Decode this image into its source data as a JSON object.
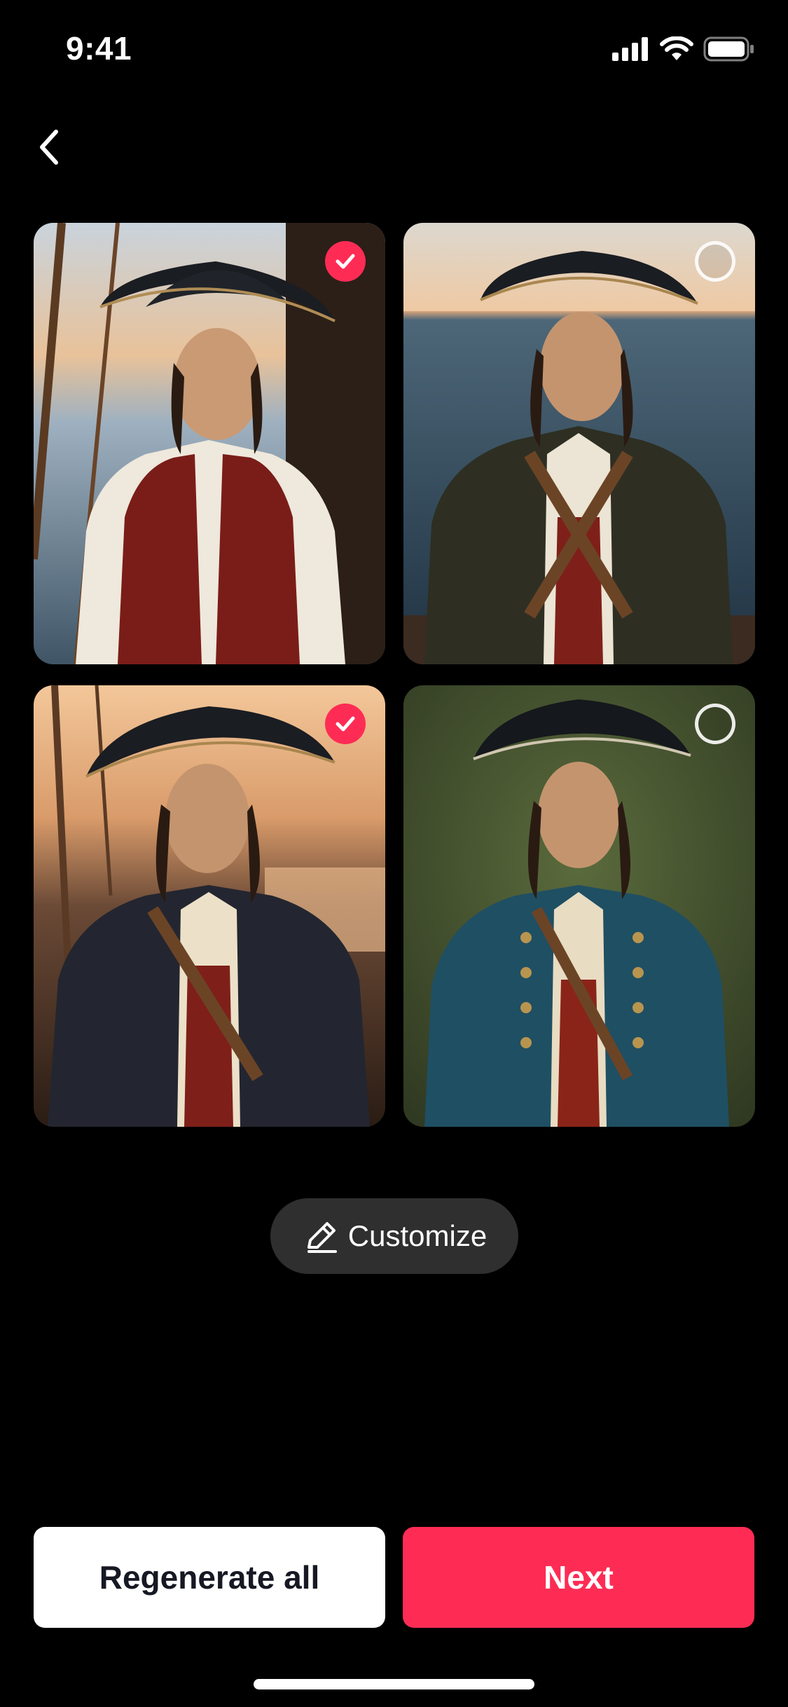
{
  "status_bar": {
    "time": "9:41",
    "icons": [
      "cellular-signal-icon",
      "wifi-icon",
      "battery-icon"
    ]
  },
  "navigation": {
    "back_icon": "chevron-left-icon"
  },
  "photos": [
    {
      "selected": true,
      "icon": "checkmark-icon"
    },
    {
      "selected": false
    },
    {
      "selected": true,
      "icon": "checkmark-icon"
    },
    {
      "selected": false
    }
  ],
  "customize": {
    "label": "Customize",
    "icon": "pencil-icon"
  },
  "actions": {
    "regenerate_label": "Regenerate all",
    "next_label": "Next"
  },
  "colors": {
    "accent": "#fe2c55",
    "background": "#000000",
    "pill": "#2f2f2f"
  }
}
